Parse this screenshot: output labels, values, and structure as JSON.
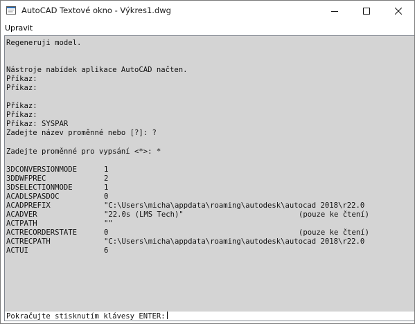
{
  "window": {
    "title": "AutoCAD Textové okno - Výkres1.dwg",
    "icon": "console-window-icon",
    "controls": {
      "minimize_icon": "minimize-icon",
      "maximize_icon": "maximize-icon",
      "close_icon": "close-icon"
    }
  },
  "menu": {
    "items": [
      "Upravit"
    ]
  },
  "console": {
    "lines": [
      "Regeneruji model.",
      "",
      "",
      "Nástroje nabídek aplikace AutoCAD načten.",
      "Příkaz:",
      "Příkaz:",
      "",
      "Příkaz:",
      "Příkaz:",
      "Příkaz: SYSPAR",
      "Zadejte název proměnné nebo [?]: ?",
      "",
      "Zadejte proměnné pro vypsání <*>: *",
      ""
    ],
    "variables": [
      {
        "name": "3DCONVERSIONMODE",
        "value": "1",
        "note": ""
      },
      {
        "name": "3DDWFPREC",
        "value": "2",
        "note": ""
      },
      {
        "name": "3DSELECTIONMODE",
        "value": "1",
        "note": ""
      },
      {
        "name": "ACADLSPASDOC",
        "value": "0",
        "note": ""
      },
      {
        "name": "ACADPREFIX",
        "value": "\"C:\\Users\\micha\\appdata\\roaming\\autodesk\\autocad 2018\\r22.0",
        "note": ""
      },
      {
        "name": "ACADVER",
        "value": "\"22.0s (LMS Tech)\"",
        "note": "(pouze ke čtení)"
      },
      {
        "name": "ACTPATH",
        "value": "\"\"",
        "note": ""
      },
      {
        "name": "ACTRECORDERSTATE",
        "value": "0",
        "note": "(pouze ke čtení)"
      },
      {
        "name": "ACTRECPATH",
        "value": "\"C:\\Users\\micha\\appdata\\roaming\\autodesk\\autocad 2018\\r22.0",
        "note": ""
      },
      {
        "name": "ACTUI",
        "value": "6",
        "note": ""
      }
    ],
    "prompt": "Pokračujte stisknutím klávesy ENTER:"
  },
  "colors": {
    "console_background": "#d4d4d4",
    "prompt_background": "#ffffff"
  }
}
